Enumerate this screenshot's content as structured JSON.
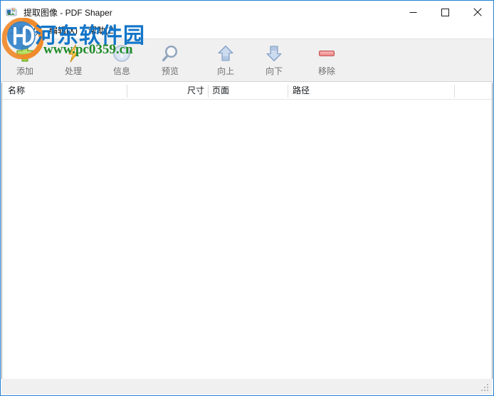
{
  "window": {
    "title": "提取图像 - PDF Shaper",
    "icon": "app-icon",
    "accent_border": "#2580d4",
    "controls": [
      {
        "name": "minimize",
        "glyph": "minimize-icon"
      },
      {
        "name": "maximize",
        "glyph": "maximize-icon"
      },
      {
        "name": "close",
        "glyph": "close-icon"
      }
    ]
  },
  "menu": {
    "items": [
      {
        "label": "文件(V)",
        "name": "menu-file"
      },
      {
        "label": "编辑(X)",
        "name": "menu-edit"
      },
      {
        "label": "帮助(Z)",
        "name": "menu-help"
      }
    ]
  },
  "toolbar": {
    "background": "#f0f0f0",
    "label_color": "#6f6f6f",
    "buttons": [
      {
        "label": "添加",
        "icon": "plus-icon",
        "color": "#8cc63f"
      },
      {
        "label": "处理",
        "icon": "lightning-icon",
        "color": "#f5a623"
      },
      {
        "label": "信息",
        "icon": "info-icon",
        "color": "#a8bcd8"
      },
      {
        "label": "预览",
        "icon": "magnifier-icon",
        "color": "#8fa4bd"
      },
      {
        "label": "向上",
        "icon": "arrow-up-icon",
        "color": "#9db4d4"
      },
      {
        "label": "向下",
        "icon": "arrow-down-icon",
        "color": "#9db4d4"
      },
      {
        "label": "移除",
        "icon": "minus-icon",
        "color": "#e08b8b"
      }
    ]
  },
  "file_list": {
    "columns": [
      {
        "label": "名称",
        "name": "column-name",
        "align": "left"
      },
      {
        "label": "尺寸",
        "name": "column-size",
        "align": "right"
      },
      {
        "label": "页面",
        "name": "column-pages",
        "align": "left"
      },
      {
        "label": "路径",
        "name": "column-path",
        "align": "left"
      }
    ],
    "rows": []
  },
  "status_bar": {
    "text": "",
    "grip": "resize-grip-icon"
  },
  "watermark": {
    "site_name": "河东软件园",
    "url": "www.pc0359.cn",
    "site_color": "#1275c8",
    "url_color": "#1f8a28",
    "logo": "hedong-logo-icon"
  }
}
